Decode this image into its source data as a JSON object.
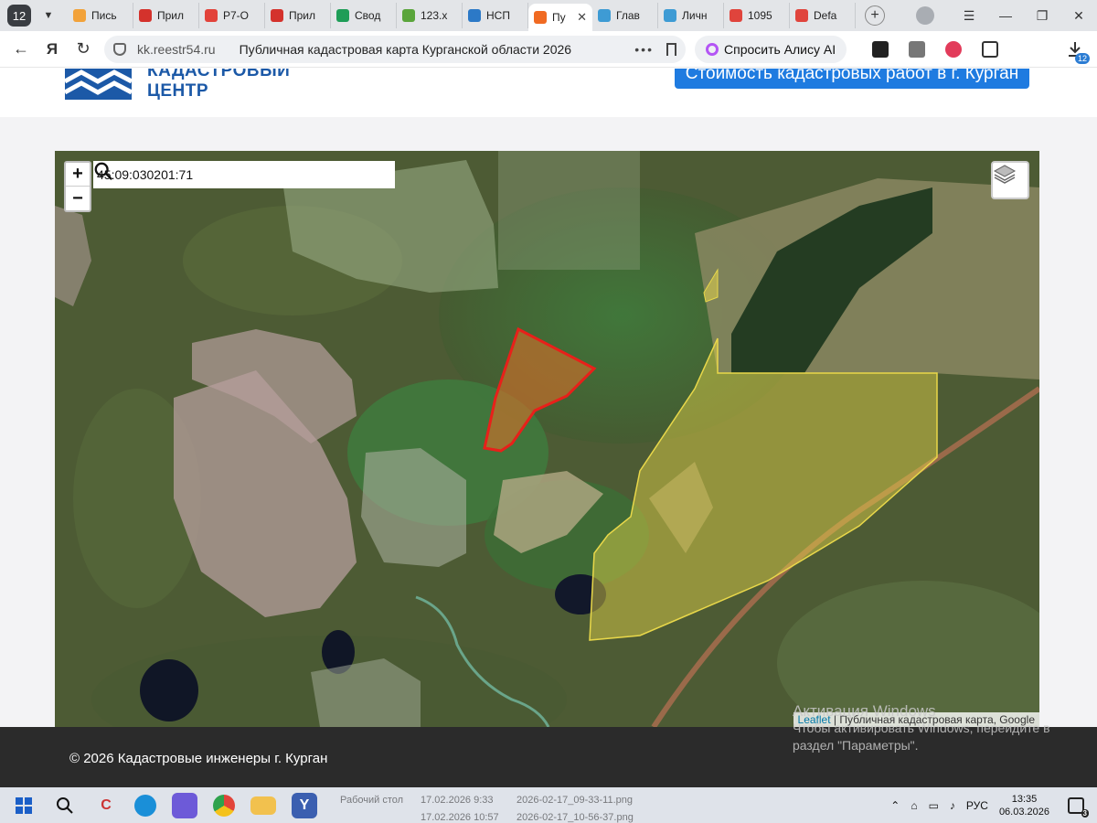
{
  "browser": {
    "tab_count": "12",
    "tabs": [
      {
        "label": "Пись",
        "color": "#f2a23a"
      },
      {
        "label": "Прил",
        "color": "#d4322c"
      },
      {
        "label": "Р7-О",
        "color": "#e2423a"
      },
      {
        "label": "Прил",
        "color": "#d4322c"
      },
      {
        "label": "Свод",
        "color": "#1e9d57"
      },
      {
        "label": "123.х",
        "color": "#5aa53b"
      },
      {
        "label": "НСП",
        "color": "#2c79c7"
      },
      {
        "label": "Пу",
        "color": "#f06a22",
        "active": true
      },
      {
        "label": "Глав",
        "color": "#3e9bd4"
      },
      {
        "label": "Личн",
        "color": "#3e9bd4"
      },
      {
        "label": "1095",
        "color": "#e0443c"
      },
      {
        "label": "Defa",
        "color": "#e0443c"
      }
    ],
    "url_domain": "kk.reestr54.ru",
    "page_title": "Публичная кадастровая карта Курганской области 2026",
    "alice_label": "Спросить Алису AI",
    "downloads_badge": "12"
  },
  "site": {
    "logo_line1": "КАДАСТРОВЫЙ",
    "logo_line2": "ЦЕНТР",
    "cta_label": "Стоимость кадастровых работ в г. Курган",
    "brand_color": "#1c59a7",
    "cta_color": "#1f7be0"
  },
  "map": {
    "search_value": "45:09:030201:71",
    "zoom_in": "+",
    "zoom_out": "−",
    "attribution_link": "Leaflet",
    "attribution_text": "| Публичная кадастровая карта, Google",
    "selected_parcel_color": "#e8201a",
    "neighbor_parcel_color": "#e9d84a"
  },
  "footer": {
    "copyright": "© 2026 Кадастровые инженеры г. Курган"
  },
  "watermark": {
    "line1": "Активация Windows",
    "line2": "Чтобы активировать Windows, перейдите в",
    "line3": "раздел \"Параметры\"."
  },
  "taskbar": {
    "lang": "РУС",
    "time": "13:35",
    "date": "06.03.2026",
    "notifications": "3",
    "ghost": {
      "desktop": "Рабочий стол",
      "date1": "17.02.2026 9:33",
      "file1": "2026-02-17_09-33-11.png",
      "date2": "17.02.2026 10:57",
      "file2": "2026-02-17_10-56-37.png"
    }
  }
}
